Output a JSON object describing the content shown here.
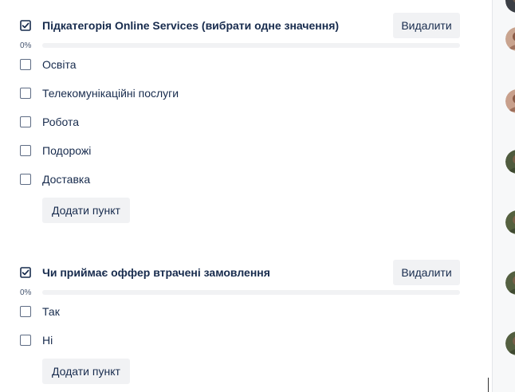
{
  "checklists": [
    {
      "title": "Підкатегорія Online Services (вибрати одне значення)",
      "delete_label": "Видалити",
      "progress_label": "0%",
      "progress": 0,
      "items": [
        {
          "label": "Освіта",
          "checked": false
        },
        {
          "label": "Телекомунікаційні послуги",
          "checked": false
        },
        {
          "label": "Робота",
          "checked": false
        },
        {
          "label": "Подорожі",
          "checked": false
        },
        {
          "label": "Доставка",
          "checked": false
        }
      ],
      "add_label": "Додати пункт"
    },
    {
      "title": "Чи приймає оффер втрачені замовлення",
      "delete_label": "Видалити",
      "progress_label": "0%",
      "progress": 0,
      "items": [
        {
          "label": "Так",
          "checked": false
        },
        {
          "label": "Ні",
          "checked": false
        }
      ],
      "add_label": "Додати пункт"
    }
  ],
  "colors": {
    "text": "#172b4d",
    "button_bg": "#f1f2f4",
    "progress_track": "#f1f2f4",
    "progress_fill": "#22a06b"
  },
  "icons": {
    "checklist": "checkbox-checked-icon",
    "avatar": "user-avatar-icon"
  }
}
